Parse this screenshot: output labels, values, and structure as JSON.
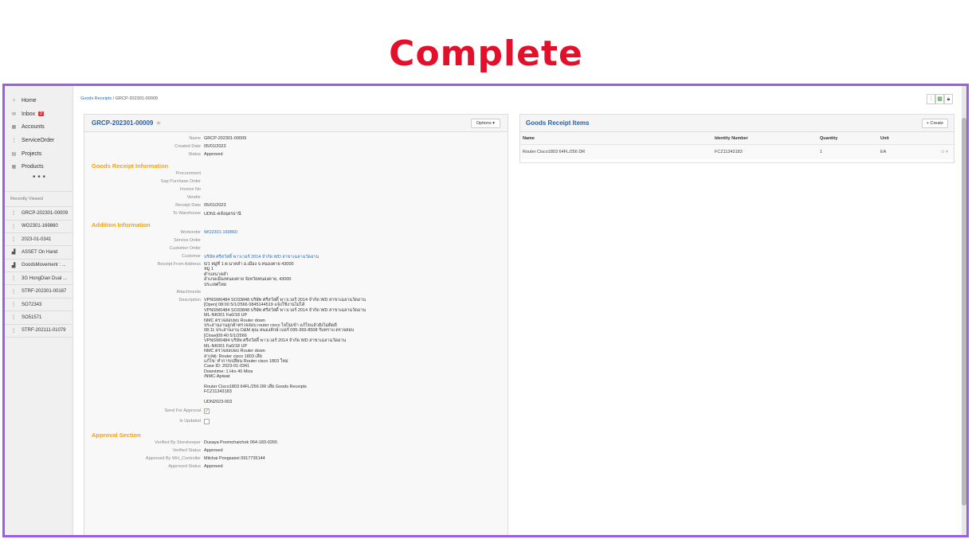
{
  "banner": {
    "title": "Complete"
  },
  "colors": {
    "banner": "#e3102b",
    "frame": "#9b5de5",
    "section_header": "#f0a31c",
    "link": "#2a6ebb"
  },
  "sidebar": {
    "nav": [
      {
        "label": "Home",
        "icon": "home-icon"
      },
      {
        "label": "Inbox",
        "icon": "envelope-icon",
        "badge": "2"
      },
      {
        "label": "Accounts",
        "icon": "building-icon"
      },
      {
        "label": "ServiceOrder",
        "icon": "document-icon"
      },
      {
        "label": "Projects",
        "icon": "grid-icon"
      },
      {
        "label": "Products",
        "icon": "box-icon"
      }
    ],
    "more": "• • •",
    "recent_heading": "Recently Viewed",
    "recent": [
      {
        "label": "GRCP-202301-00009",
        "icon": "document-icon"
      },
      {
        "label": "WO2301-169860",
        "icon": "document-icon"
      },
      {
        "label": "2023-01-0341",
        "icon": "document-icon"
      },
      {
        "label": "ASSET On Hand",
        "icon": "report-icon"
      },
      {
        "label": "GoodsMovement : ...",
        "icon": "report-icon"
      },
      {
        "label": "3G HongDian Dual ...",
        "icon": "document-icon"
      },
      {
        "label": "STRF-202301-00167",
        "icon": "document-icon"
      },
      {
        "label": "SO72343",
        "icon": "document-icon"
      },
      {
        "label": "SO51571",
        "icon": "document-icon"
      },
      {
        "label": "STRF-202111-01079",
        "icon": "document-icon"
      }
    ]
  },
  "breadcrumb": {
    "parent": "Goods Receipts",
    "separator": " / ",
    "current": "GRCP-202301-00009"
  },
  "view_tools": {
    "filter_icon": "filter-icon",
    "grid_icon": "grid-view-icon",
    "lock_icon": "lock-icon"
  },
  "detail": {
    "title": "GRCP-202301-00009",
    "options_label": "Options ▾",
    "top_fields": [
      {
        "label": "Name",
        "value": "GRCP-202301-00009"
      },
      {
        "label": "Created Date",
        "value": "05/01/2023"
      },
      {
        "label": "Status",
        "value": "Approved"
      }
    ],
    "section_info": "Goods Receipt Information",
    "info_fields": [
      {
        "label": "Procurement",
        "value": ""
      },
      {
        "label": "Sap Purchase Order",
        "value": ""
      },
      {
        "label": "Invoice No",
        "value": ""
      },
      {
        "label": "Vendor",
        "value": ""
      },
      {
        "label": "Receipt Date",
        "value": "05/01/2023"
      },
      {
        "label": "To Warehouse",
        "value": "UDN1-คลังอุดรธานี"
      }
    ],
    "section_addition": "Addition Information",
    "addition_fields": [
      {
        "label": "Workorder",
        "value": "WO2301-169860"
      },
      {
        "label": "Service Order",
        "value": ""
      },
      {
        "label": "Customer Order",
        "value": ""
      },
      {
        "label": "Customer",
        "value": "บริษัท ศรีสวัสดิ์ พาวเวอร์ 2014 จำกัด WD สาขาเฉลาฉวัดอาน"
      }
    ],
    "address_label": "Receipt From Address",
    "address_lines": [
      "6/1 หมู่ที่ 1 ต.นาคลำ อ.เมือง จ.หนองคาย 43000",
      "หมู่ 1",
      "ตำบลนาคลำ",
      "อำเภอเมืองหนองคาย จังหวัดหนองคาย, 43000",
      "ประเทศไทย"
    ],
    "attachments_label": "Attachments",
    "description_label": "Description",
    "description_lines": [
      "VPNSW0484 SO33848 บริษัท ศรีสวัสดิ์ พาวเวอร์ 2014 จำกัด WD สาขาเฉลาฉวัดอาน",
      "[Open] 08:00 5/1/2566 0845144519 แจ้งใช้งานไม่ได้",
      "VPNSW0484 SO33848 บริษัท ศรีสวัสดิ์ พาวเวอร์ 2014 จำกัด WD สาขาเฉลาฉวัดอาน",
      "ML-NK001 Fa0/18 UP",
      "NMC ตรวจสอบพบ Router down",
      "ประสานงานลูกค้าตรวจสอบ router cisco ไฟไม่เข้า แก้ไขแล้วยังไม่ติดดี",
      "08:11 ประสานงาน O&M คุณ หนองลักษ์ เบอร์ 095-369-8508 รับทราบ ตรวจสอบ",
      "[Close]09:40 5/1/2566",
      "VPNSW0484 บริษัท ศรีสวัสดิ์ พาวเวอร์ 2014 จำกัด WD สาขาเฉลาฉวัดอาน",
      "ML-NK001 Fa0/18 UP",
      "NMC ตรวจสอบพบ Router down",
      "สาเหตุ: Router cisco 1803 เสีย",
      "แก้ไข: ทำการเปลี่ยน Router cisco 1803 ใหม่",
      "Case ID: 2023-01-0341",
      "Downtime: 1 Hrs 40 Mins",
      "/NMC-Apiwat",
      "",
      "Router Cisco1803 64FL/256 DR เสีย Goods Receipts",
      "FCZ11343183",
      "",
      "UDN2023-003"
    ],
    "send_approval_label": "Send For Approval",
    "send_approval_mark": "✓",
    "is_updated_label": "Is Updated",
    "section_approval": "Approval Section",
    "approval_fields": [
      {
        "label": "Verified By Storekeeper",
        "value": "Dusaya Poomchaichok 064-183-0265"
      },
      {
        "label": "Verified Status",
        "value": "Approved"
      },
      {
        "label": "Approved By WH_Controller",
        "value": "Mitchai Pongsaisri 0917735144"
      },
      {
        "label": "Approved Status",
        "value": "Approved"
      }
    ]
  },
  "items": {
    "title": "Goods Receipt Items",
    "create_label": "+ Create",
    "columns": [
      "Name",
      "Identity Number",
      "Quantity",
      "Unit"
    ],
    "rows": [
      {
        "name": "Router Cisco1803 64FL/256 DR",
        "identity": "FCZ11343183",
        "quantity": "1",
        "unit": "EA",
        "action": "⊙ ▾"
      }
    ]
  }
}
